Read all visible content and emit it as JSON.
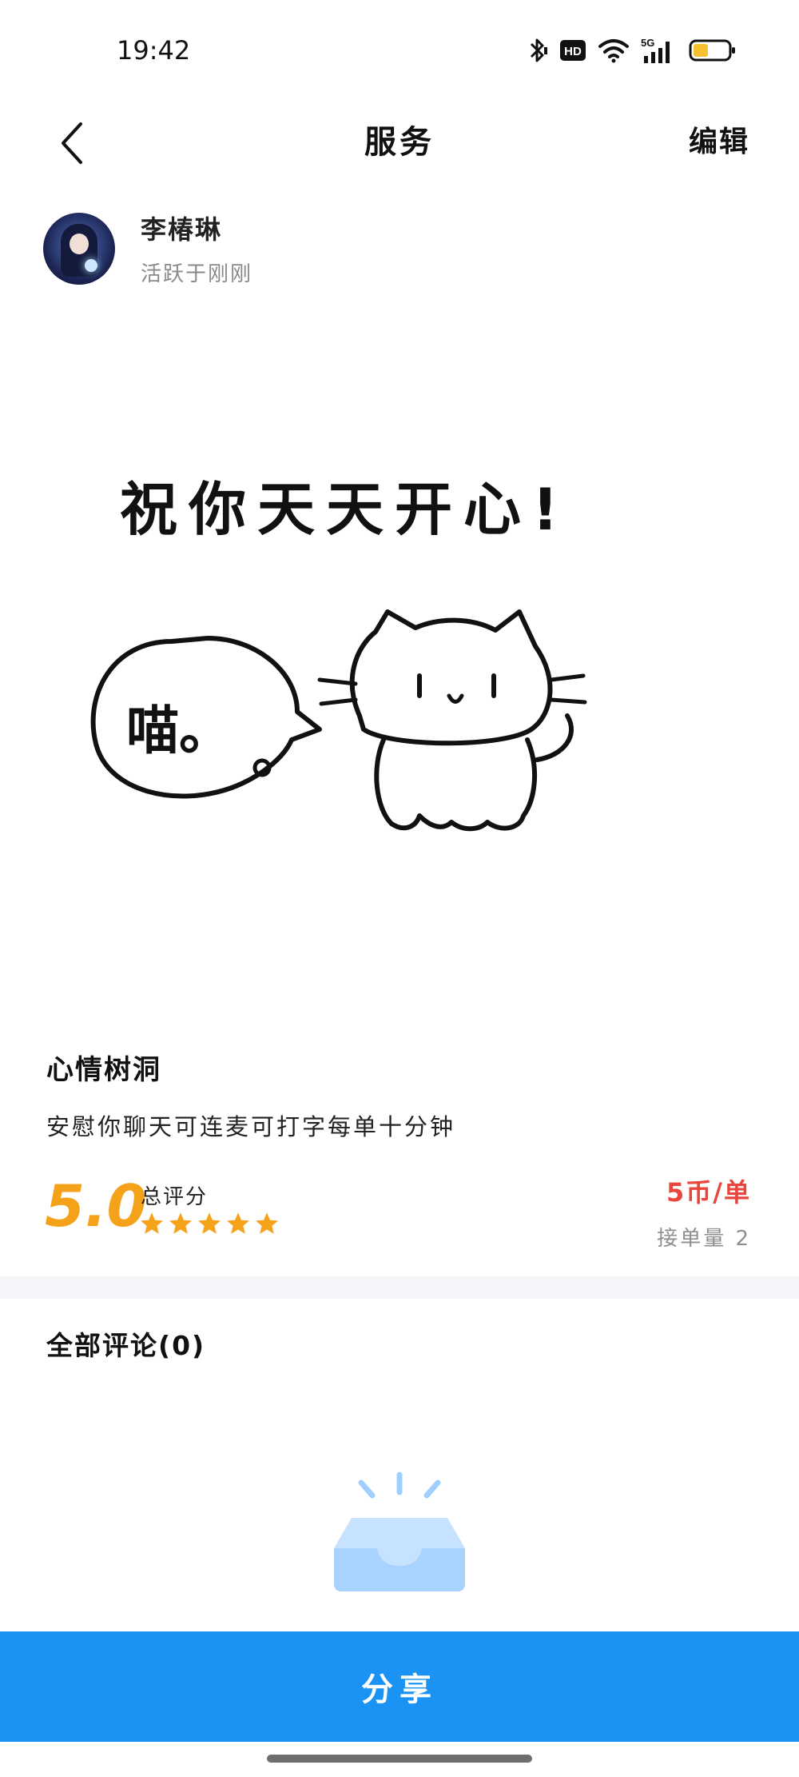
{
  "status_bar": {
    "time": "19:42",
    "icons": [
      "bluetooth-icon",
      "hd-icon",
      "wifi-icon",
      "signal-5g-icon",
      "battery-icon"
    ],
    "hd_label": "HD",
    "network_label": "5G",
    "battery_color": "#f6c12e"
  },
  "nav": {
    "back_icon": "chevron-left-icon",
    "title": "服务",
    "edit_label": "编辑"
  },
  "profile": {
    "name": "李椿琳",
    "active_status": "活跃于刚刚"
  },
  "hero_image": {
    "headline": "祝你天天开心!",
    "bubble_text": "喵。"
  },
  "service": {
    "title": "心情树洞",
    "description": "安慰你聊天可连麦可打字每单十分钟"
  },
  "rating": {
    "score": "5.0",
    "label": "总评分",
    "stars": 5,
    "star_color": "#f5a21b"
  },
  "pricing": {
    "price": "5币/单",
    "orders": "接单量 2",
    "price_color": "#e8463c"
  },
  "comments": {
    "heading": "全部评论(0)"
  },
  "empty_state": {
    "icon": "empty-box-icon"
  },
  "actions": {
    "share_label": "分享",
    "share_color": "#1b93f5"
  }
}
